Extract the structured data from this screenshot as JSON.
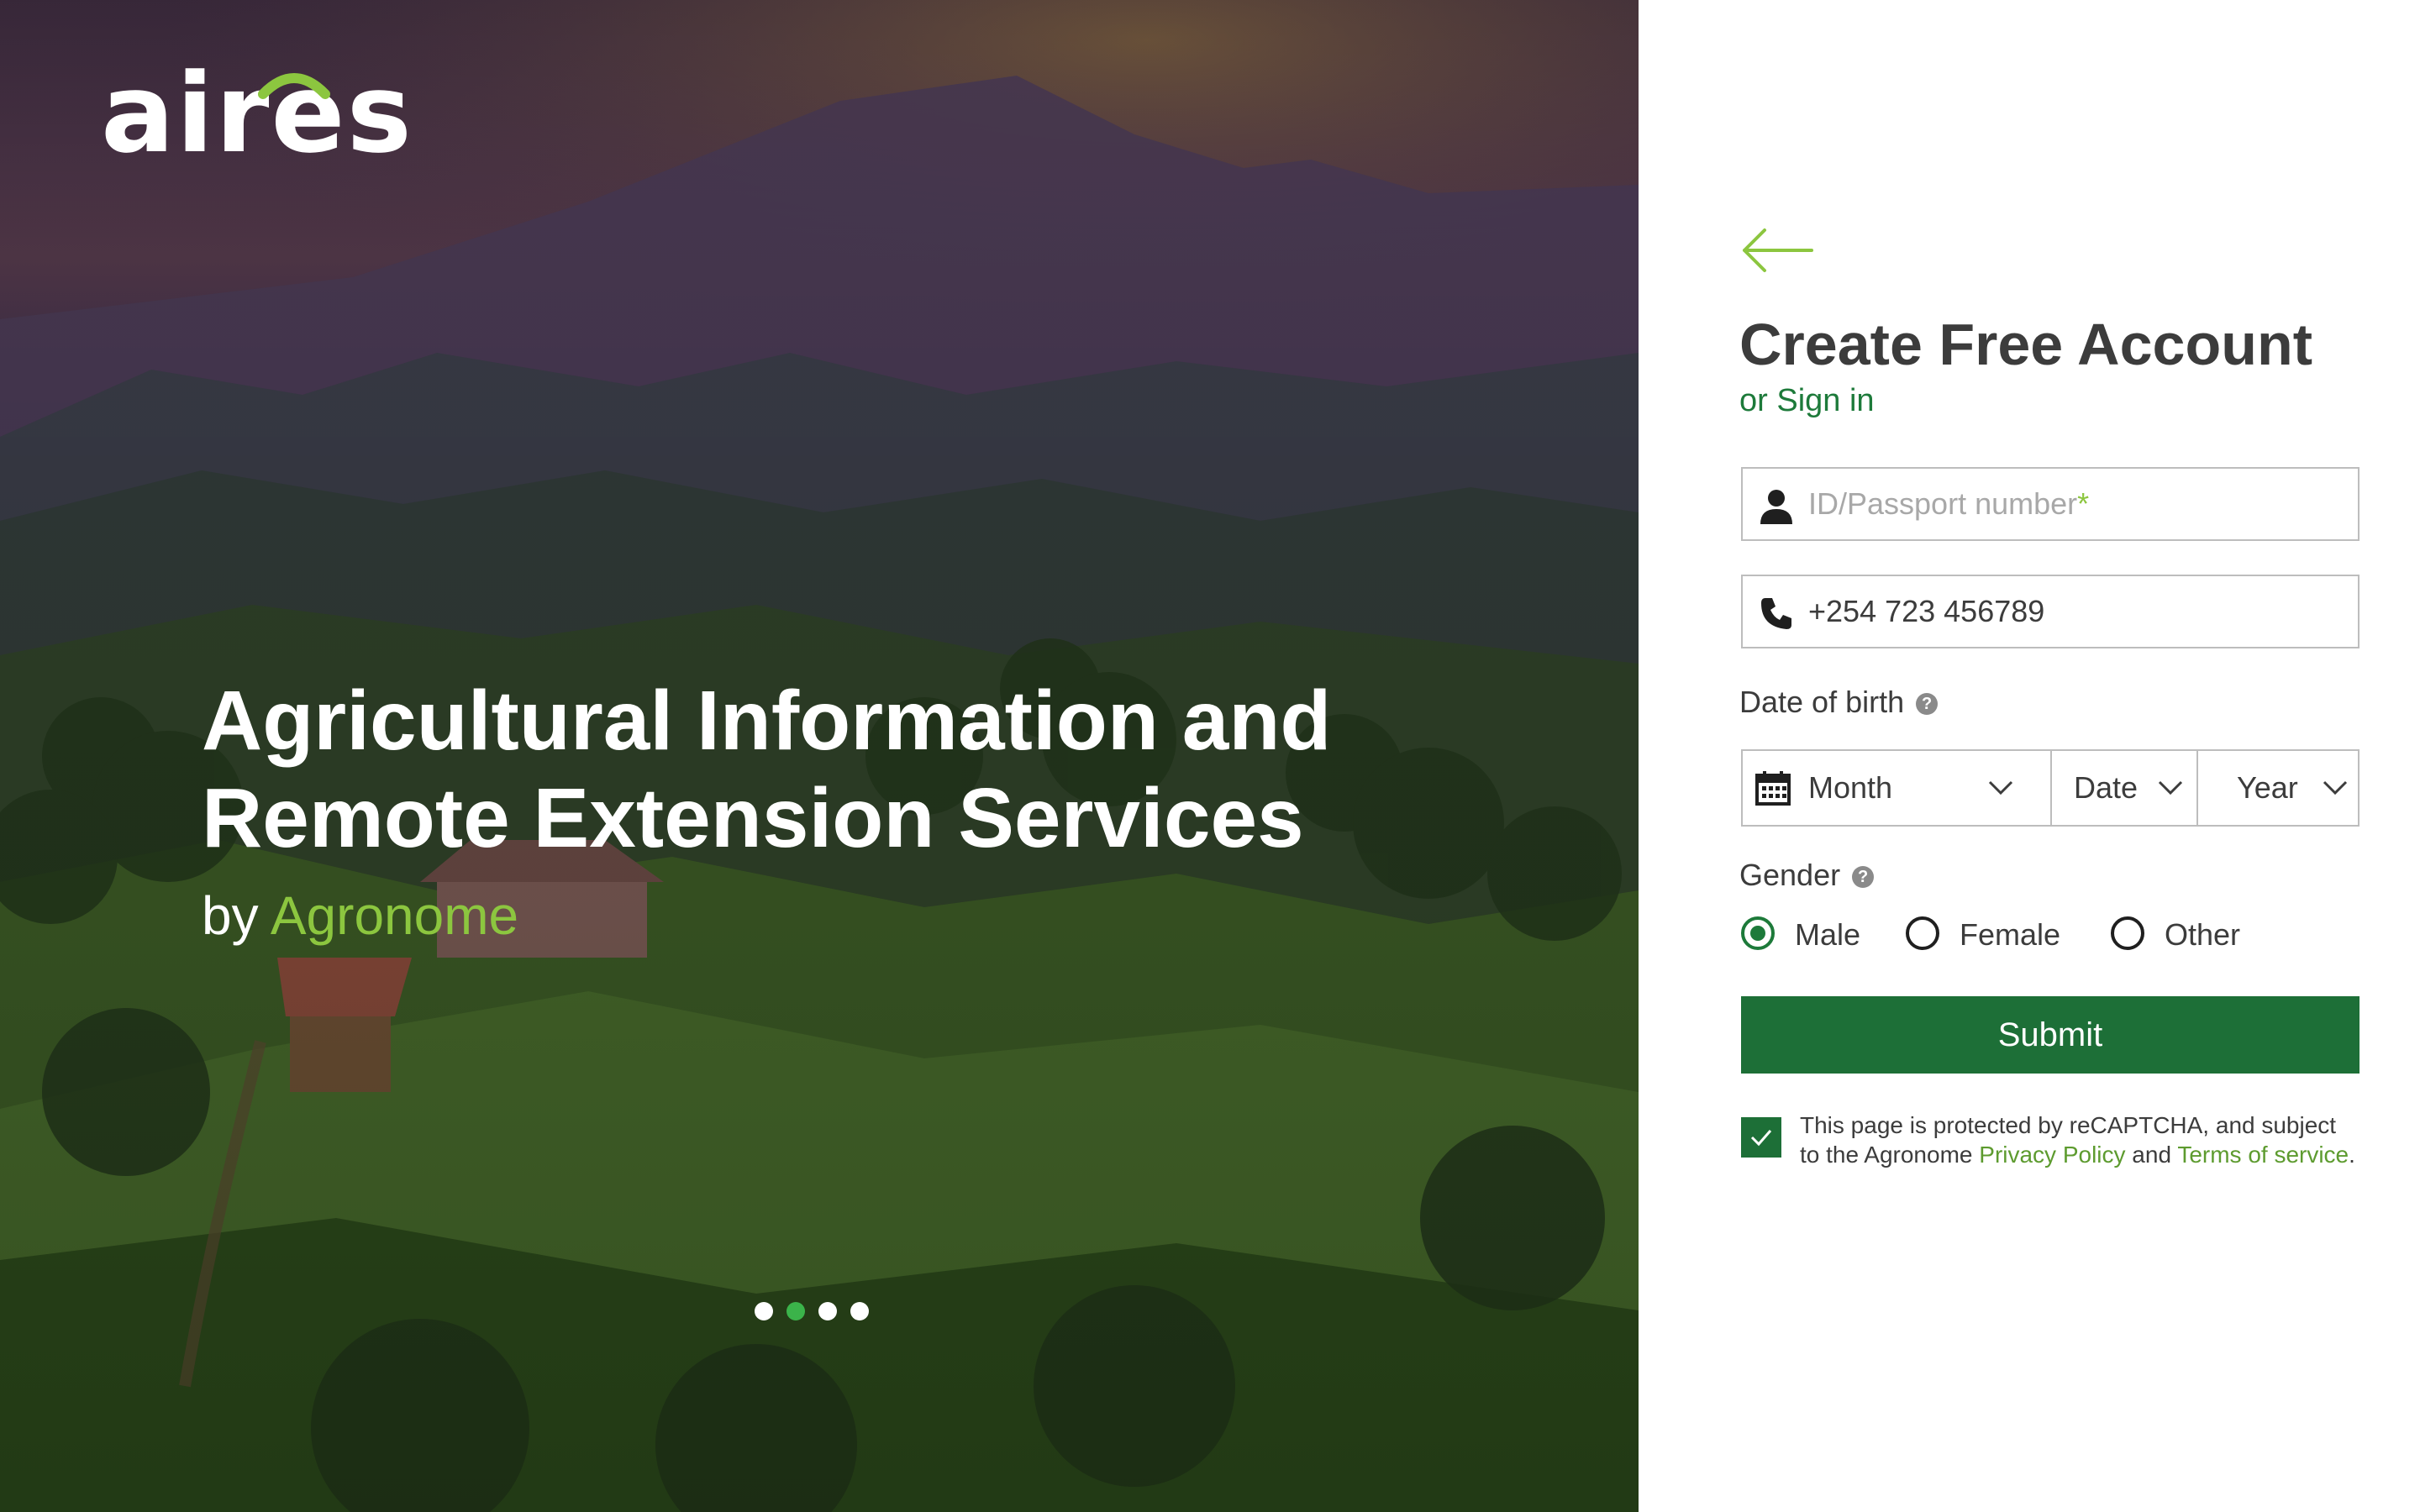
{
  "brand": {
    "logo_text": "aires"
  },
  "hero": {
    "title_line1": "Agricultural Information and",
    "title_line2": "Remote Extension Services",
    "by_prefix": "by",
    "by_brand": "Agronome",
    "carousel": {
      "count": 4,
      "active_index": 1
    }
  },
  "form": {
    "title": "Create Free Account",
    "signin_link": "or Sign in",
    "id_field": {
      "placeholder": "ID/Passport number",
      "required_mark": "*",
      "value": ""
    },
    "phone_field": {
      "value": "+254 723 456789"
    },
    "dob": {
      "label": "Date of birth",
      "help": "?",
      "month": "Month",
      "date": "Date",
      "year": "Year"
    },
    "gender": {
      "label": "Gender",
      "help": "?",
      "options": [
        "Male",
        "Female",
        "Other"
      ],
      "selected": "Male"
    },
    "submit_label": "Submit",
    "captcha": {
      "checked": true,
      "text_line1": "This page is protected by reCAPTCHA, and subject",
      "text_prefix2": "to the Agronome ",
      "privacy_link": "Privacy Policy",
      "and_text": " and ",
      "terms_link": "Terms of service",
      "period": "."
    }
  },
  "colors": {
    "primary_green": "#1d6f37",
    "accent_green": "#8cc63f",
    "link_green": "#5d9b2f",
    "text_dark": "#3c3c3c"
  }
}
